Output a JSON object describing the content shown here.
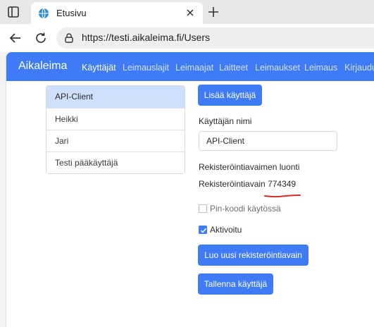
{
  "browser": {
    "tab": {
      "title": "Etusivu"
    },
    "address": {
      "url": "https://testi.aikaleima.fi/Users"
    }
  },
  "navbar": {
    "brand": "Aikaleima",
    "links": [
      {
        "label": "Käyttäjät",
        "active": true
      },
      {
        "label": "Leimauslajit",
        "active": false
      },
      {
        "label": "Leimaajat",
        "active": false
      },
      {
        "label": "Laitteet",
        "active": false
      },
      {
        "label": "Leimaukset",
        "active": false
      },
      {
        "label": "Leimaus",
        "active": false
      },
      {
        "label": "Kirjaudu",
        "active": false
      }
    ]
  },
  "users": [
    {
      "name": "API-Client",
      "selected": true
    },
    {
      "name": "Heikki",
      "selected": false
    },
    {
      "name": "Jari",
      "selected": false
    },
    {
      "name": "Testi pääkäyttäjä",
      "selected": false
    }
  ],
  "form": {
    "add_user_button": "Lisää käyttäjä",
    "username_label": "Käyttäjän nimi",
    "username_value": "API-Client",
    "registration_heading": "Rekisteröintiavaimen luonti",
    "registration_key_label": "Rekisteröintiavain",
    "registration_key_value": "774349",
    "pin_checkbox": {
      "label": "Pin-koodi käytössä",
      "checked": false
    },
    "active_checkbox": {
      "label": "Aktivoitu",
      "checked": true
    },
    "generate_key_button": "Luo uusi rekisteröintiavain",
    "save_button": "Tallenna käyttäjä"
  },
  "colors": {
    "accent": "#3f7bf6",
    "selected_row": "#cfe0fc",
    "annotation_underline": "#d92a2a"
  }
}
